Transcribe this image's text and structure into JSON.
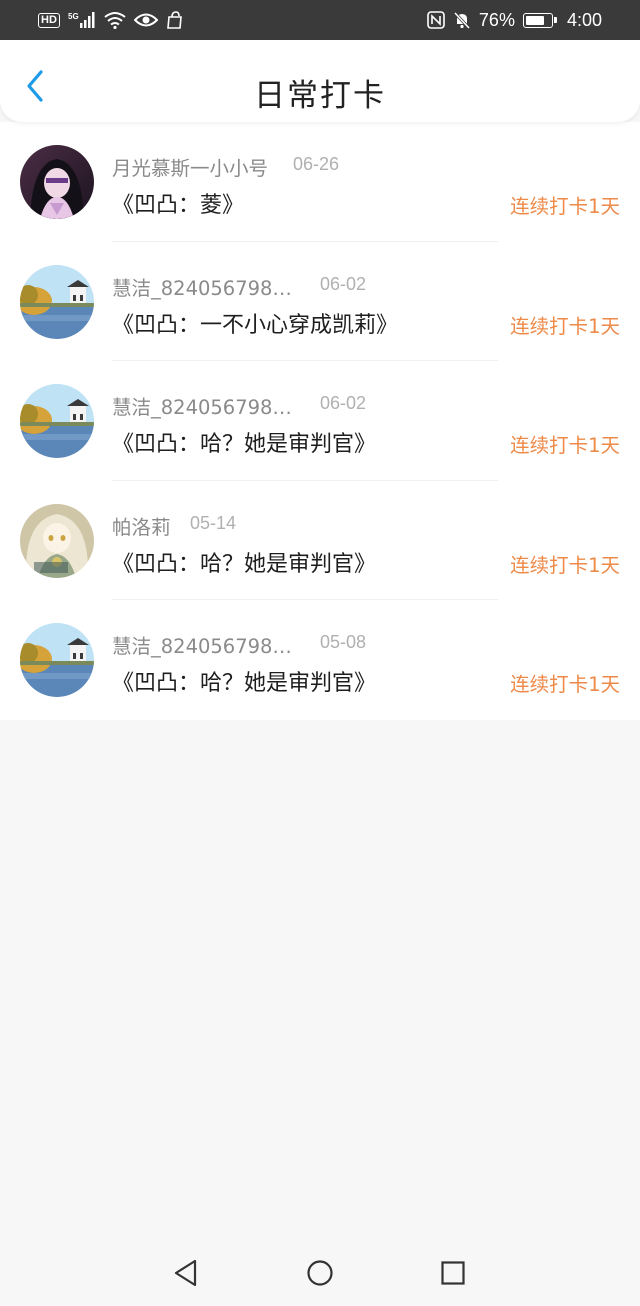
{
  "status_bar": {
    "hd": "HD",
    "network": "5G",
    "battery": "76%",
    "battery_level": 0.76,
    "time": "4:00"
  },
  "header": {
    "title": "日常打卡"
  },
  "items": [
    {
      "username": "月光慕斯一小小号",
      "date": "06-26",
      "book": "《凹凸：菱》",
      "streak": "连续打卡1天",
      "avatar": "dark-hair-girl-avatar"
    },
    {
      "username": "慧洁_8240567985...",
      "date": "06-02",
      "book": "《凹凸：一不小心穿成凯莉》",
      "streak": "连续打卡1天",
      "avatar": "landscape-pavilion-avatar"
    },
    {
      "username": "慧洁_8240567985...",
      "date": "06-02",
      "book": "《凹凸：哈？她是审判官》",
      "streak": "连续打卡1天",
      "avatar": "landscape-pavilion-avatar"
    },
    {
      "username": "帕洛莉",
      "date": "05-14",
      "book": "《凹凸：哈？她是审判官》",
      "streak": "连续打卡1天",
      "avatar": "anime-girl-pillos-avatar"
    },
    {
      "username": "慧洁_8240567985...",
      "date": "05-08",
      "book": "《凹凸：哈？她是审判官》",
      "streak": "连续打卡1天",
      "avatar": "landscape-pavilion-avatar"
    }
  ],
  "colors": {
    "accent": "#1e9be8",
    "streak": "#ee8a48"
  }
}
